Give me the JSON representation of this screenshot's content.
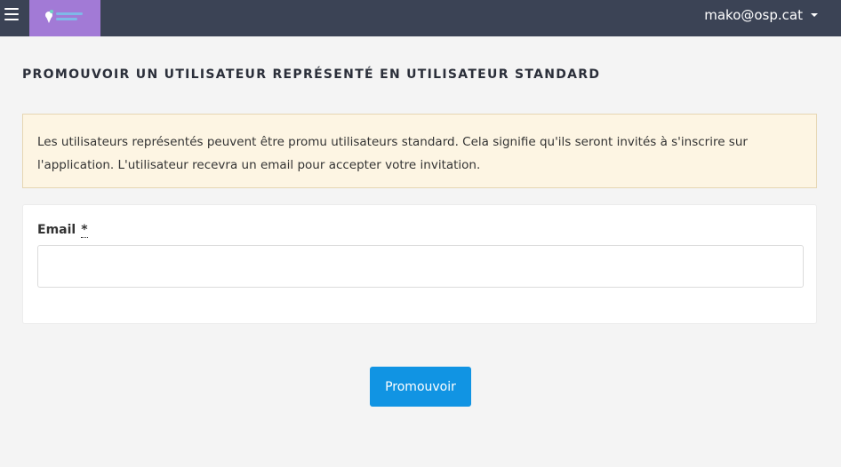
{
  "header": {
    "user": "mako@osp.cat",
    "logo_icon": "app-logo",
    "menu_icon": "hamburger-menu-icon"
  },
  "page": {
    "title": "PROMOUVOIR UN UTILISATEUR REPRÉSENTÉ EN UTILISATEUR STANDARD"
  },
  "alert": {
    "line1": "Les utilisateurs représentés peuvent être promu utilisateurs standard. Cela signifie qu'ils seront invités à s'inscrire sur",
    "line2": "l'application. L'utilisateur recevra un email pour accepter votre invitation."
  },
  "form": {
    "email_label": "Email",
    "required_marker": "*",
    "email_value": "",
    "email_placeholder": ""
  },
  "actions": {
    "submit_label": "Promouvoir"
  },
  "colors": {
    "topbar": "#3b4355",
    "logo_bg": "#a27ad6",
    "alert_bg": "#fdf5e3",
    "primary": "#1194e3"
  }
}
